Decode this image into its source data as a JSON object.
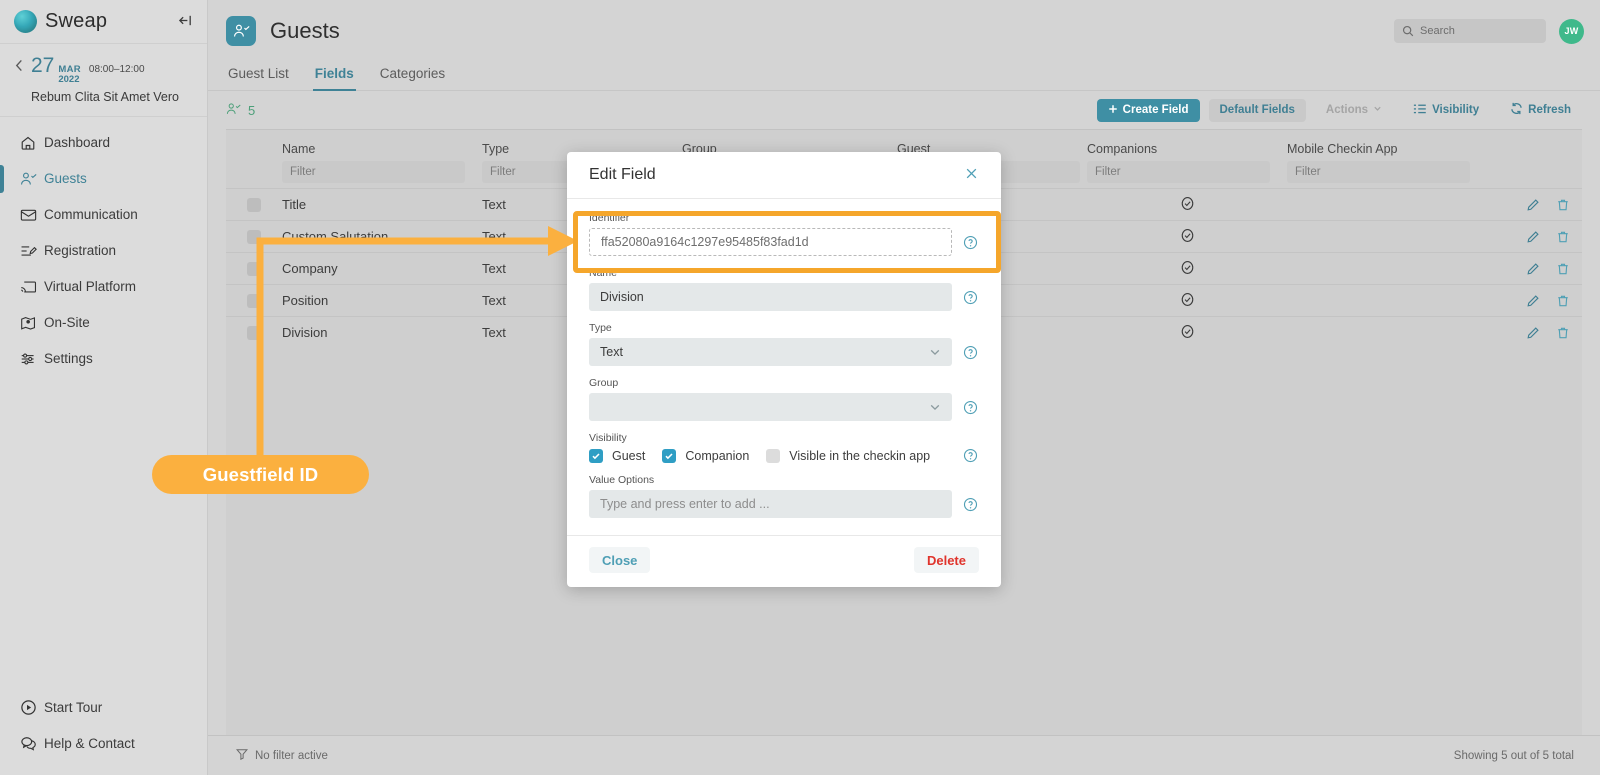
{
  "sidebar": {
    "brand": "Sweap",
    "collapse_icon": "collapse-panel-icon",
    "event": {
      "day": "27",
      "month": "MAR",
      "year": "2022",
      "time": "08:00–12:00",
      "name": "Rebum Clita Sit Amet Vero"
    },
    "items": [
      {
        "label": "Dashboard",
        "icon": "home-icon",
        "active": false
      },
      {
        "label": "Guests",
        "icon": "user-check-icon",
        "active": true
      },
      {
        "label": "Communication",
        "icon": "envelope-icon",
        "active": false
      },
      {
        "label": "Registration",
        "icon": "form-edit-icon",
        "active": false
      },
      {
        "label": "Virtual Platform",
        "icon": "cast-screen-icon",
        "active": false
      },
      {
        "label": "On-Site",
        "icon": "map-pin-icon",
        "active": false
      },
      {
        "label": "Settings",
        "icon": "sliders-icon",
        "active": false
      }
    ],
    "bottom_items": [
      {
        "label": "Start Tour",
        "icon": "play-circle-icon"
      },
      {
        "label": "Help & Contact",
        "icon": "chat-bubbles-icon"
      }
    ]
  },
  "header": {
    "title": "Guests",
    "page_icon": "user-check-icon",
    "search_placeholder": "Search",
    "search_value": "",
    "avatar_initials": "JW"
  },
  "tabs": [
    {
      "label": "Guest List",
      "active": false
    },
    {
      "label": "Fields",
      "active": true
    },
    {
      "label": "Categories",
      "active": false
    }
  ],
  "toolbar": {
    "count": "5",
    "count_icon": "user-check-icon",
    "create_field": "Create Field",
    "default_fields": "Default Fields",
    "actions": "Actions",
    "visibility": "Visibility",
    "refresh": "Refresh"
  },
  "table": {
    "columns": [
      "Name",
      "Type",
      "Group",
      "Guest",
      "Companions",
      "Mobile Checkin App"
    ],
    "filter_placeholder": "Filter",
    "rows": [
      {
        "name": "Title",
        "type": "Text",
        "group": "",
        "guest": "",
        "companions": "check",
        "mobile": ""
      },
      {
        "name": "Custom Salutation",
        "type": "Text",
        "group": "",
        "guest": "",
        "companions": "check",
        "mobile": ""
      },
      {
        "name": "Company",
        "type": "Text",
        "group": "",
        "guest": "",
        "companions": "check",
        "mobile": ""
      },
      {
        "name": "Position",
        "type": "Text",
        "group": "",
        "guest": "",
        "companions": "check",
        "mobile": ""
      },
      {
        "name": "Division",
        "type": "Text",
        "group": "",
        "guest": "",
        "companions": "check",
        "mobile": ""
      }
    ]
  },
  "statusbar": {
    "filter_text": "No filter active",
    "showing_text": "Showing 5 out of 5 total"
  },
  "modal": {
    "title": "Edit Field",
    "identifier_label": "Identifier",
    "identifier_value": "ffa52080a9164c1297e95485f83fad1d",
    "name_label": "Name",
    "name_value": "Division",
    "type_label": "Type",
    "type_value": "Text",
    "group_label": "Group",
    "group_value": "",
    "visibility_label": "Visibility",
    "visibility": [
      {
        "label": "Guest",
        "checked": true
      },
      {
        "label": "Companion",
        "checked": true
      },
      {
        "label": "Visible in the checkin app",
        "checked": false
      }
    ],
    "value_options_label": "Value Options",
    "value_options_placeholder": "Type and press enter to add ...",
    "close_label": "Close",
    "delete_label": "Delete"
  },
  "annotation": {
    "bubble_label": "Guestfield ID",
    "color": "#fbb03f"
  }
}
